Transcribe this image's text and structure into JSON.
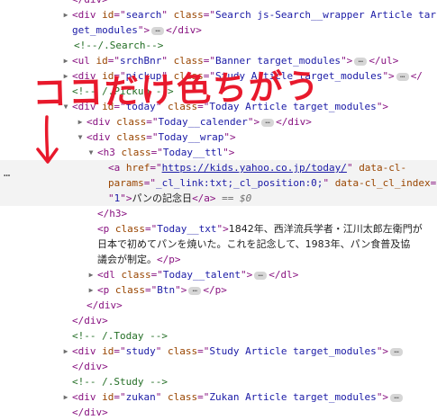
{
  "devtools": {
    "lines": [
      {
        "indent": 80,
        "arrow": "right",
        "html": [
          [
            "tag",
            "<div "
          ],
          [
            "attr",
            "id"
          ],
          [
            "tag",
            "=\""
          ],
          [
            "val",
            "search"
          ],
          [
            "tag",
            "\" "
          ],
          [
            "attr",
            "class"
          ],
          [
            "tag",
            "=\""
          ],
          [
            "val",
            "Search js-Search__wrapper Article tar"
          ]
        ]
      },
      {
        "indent": 80,
        "arrow": "",
        "html": [
          [
            "val",
            "get_modules"
          ],
          [
            "tag",
            "\">"
          ],
          [
            "pill",
            "…"
          ],
          [
            "tag",
            "</div>"
          ]
        ]
      },
      {
        "indent": 82,
        "arrow": "",
        "html": [
          [
            "cmt",
            "<!--/.Search-->"
          ]
        ]
      },
      {
        "indent": 80,
        "arrow": "right",
        "html": [
          [
            "tag",
            "<ul "
          ],
          [
            "attr",
            "id"
          ],
          [
            "tag",
            "=\""
          ],
          [
            "val",
            "srchBnr"
          ],
          [
            "tag",
            "\" "
          ],
          [
            "attr",
            "class"
          ],
          [
            "tag",
            "=\""
          ],
          [
            "val",
            "Banner target_modules"
          ],
          [
            "tag",
            "\">"
          ],
          [
            "pill",
            "…"
          ],
          [
            "tag",
            "</ul>"
          ]
        ]
      },
      {
        "indent": 80,
        "arrow": "right",
        "html": [
          [
            "tag",
            "<div "
          ],
          [
            "attr",
            "id"
          ],
          [
            "tag",
            "=\""
          ],
          [
            "val",
            "pickup"
          ],
          [
            "tag",
            "\" "
          ],
          [
            "attr",
            "class"
          ],
          [
            "tag",
            "=\""
          ],
          [
            "val",
            "Study Article target_modules"
          ],
          [
            "tag",
            "\">"
          ],
          [
            "pill",
            "…"
          ],
          [
            "tag",
            "</"
          ]
        ]
      },
      {
        "indent": 80,
        "arrow": "",
        "html": [
          [
            "cmt",
            "<!-- /.Pickup -->"
          ]
        ]
      },
      {
        "indent": 80,
        "arrow": "down",
        "html": [
          [
            "tag",
            "<div "
          ],
          [
            "attr",
            "id"
          ],
          [
            "tag",
            "=\""
          ],
          [
            "val",
            "today"
          ],
          [
            "tag",
            "\" "
          ],
          [
            "attr",
            "class"
          ],
          [
            "tag",
            "=\""
          ],
          [
            "val",
            "Today Article target_modules"
          ],
          [
            "tag",
            "\">"
          ]
        ]
      },
      {
        "indent": 96,
        "arrow": "right",
        "html": [
          [
            "tag",
            "<div "
          ],
          [
            "attr",
            "class"
          ],
          [
            "tag",
            "=\""
          ],
          [
            "val",
            "Today__calender"
          ],
          [
            "tag",
            "\">"
          ],
          [
            "pill",
            "…"
          ],
          [
            "tag",
            "</div>"
          ]
        ]
      },
      {
        "indent": 96,
        "arrow": "down",
        "html": [
          [
            "tag",
            "<div "
          ],
          [
            "attr",
            "class"
          ],
          [
            "tag",
            "=\""
          ],
          [
            "val",
            "Today__wrap"
          ],
          [
            "tag",
            "\">"
          ]
        ]
      },
      {
        "indent": 108,
        "arrow": "down",
        "html": [
          [
            "tag",
            "<h3 "
          ],
          [
            "attr",
            "class"
          ],
          [
            "tag",
            "=\""
          ],
          [
            "val",
            "Today__ttl"
          ],
          [
            "tag",
            "\">"
          ]
        ]
      },
      {
        "indent": 120,
        "arrow": "",
        "selected": true,
        "html": [
          [
            "tag",
            "<a "
          ],
          [
            "attr",
            "href"
          ],
          [
            "tag",
            "=\""
          ],
          [
            "link",
            "https://kids.yahoo.co.jp/today/"
          ],
          [
            "tag",
            "\" "
          ],
          [
            "attr",
            "data-cl-"
          ]
        ]
      },
      {
        "indent": 120,
        "arrow": "",
        "selected": true,
        "html": [
          [
            "attr",
            "params"
          ],
          [
            "tag",
            "=\""
          ],
          [
            "val",
            "_cl_link:txt;_cl_position:0;"
          ],
          [
            "tag",
            "\" "
          ],
          [
            "attr",
            "data-cl_cl_index"
          ],
          [
            "tag",
            "="
          ]
        ]
      },
      {
        "indent": 120,
        "arrow": "",
        "selected": true,
        "html": [
          [
            "tag",
            "\""
          ],
          [
            "val",
            "1"
          ],
          [
            "tag",
            "\">"
          ],
          [
            "txt",
            "パンの記念日"
          ],
          [
            "tag",
            "</a>"
          ],
          [
            "eq",
            " == $0"
          ]
        ]
      },
      {
        "indent": 108,
        "arrow": "",
        "html": [
          [
            "tag",
            "</h3>"
          ]
        ]
      },
      {
        "indent": 108,
        "arrow": "",
        "html": [
          [
            "tag",
            "<p "
          ],
          [
            "attr",
            "class"
          ],
          [
            "tag",
            "=\""
          ],
          [
            "val",
            "Today__txt"
          ],
          [
            "tag",
            "\">"
          ],
          [
            "txt",
            "1842年、西洋流兵学者・江川太郎左衛門が"
          ]
        ]
      },
      {
        "indent": 108,
        "arrow": "",
        "html": [
          [
            "txt",
            "日本で初めてパンを焼いた。これを記念して、1983年、パン食普及協"
          ]
        ]
      },
      {
        "indent": 108,
        "arrow": "",
        "html": [
          [
            "txt",
            "議会が制定。"
          ],
          [
            "tag",
            "</p>"
          ]
        ]
      },
      {
        "indent": 108,
        "arrow": "right",
        "html": [
          [
            "tag",
            "<dl "
          ],
          [
            "attr",
            "class"
          ],
          [
            "tag",
            "=\""
          ],
          [
            "val",
            "Today__talent"
          ],
          [
            "tag",
            "\">"
          ],
          [
            "pill",
            "…"
          ],
          [
            "tag",
            "</dl>"
          ]
        ]
      },
      {
        "indent": 108,
        "arrow": "right",
        "html": [
          [
            "tag",
            "<p "
          ],
          [
            "attr",
            "class"
          ],
          [
            "tag",
            "=\""
          ],
          [
            "val",
            "Btn"
          ],
          [
            "tag",
            "\">"
          ],
          [
            "pill",
            "…"
          ],
          [
            "tag",
            "</p>"
          ]
        ]
      },
      {
        "indent": 96,
        "arrow": "",
        "html": [
          [
            "tag",
            "</div>"
          ]
        ]
      },
      {
        "indent": 80,
        "arrow": "",
        "html": [
          [
            "tag",
            "</div>"
          ]
        ]
      },
      {
        "indent": 80,
        "arrow": "",
        "html": [
          [
            "cmt",
            "<!-- /.Today -->"
          ]
        ]
      },
      {
        "indent": 80,
        "arrow": "right",
        "html": [
          [
            "tag",
            "<div "
          ],
          [
            "attr",
            "id"
          ],
          [
            "tag",
            "=\""
          ],
          [
            "val",
            "study"
          ],
          [
            "tag",
            "\" "
          ],
          [
            "attr",
            "class"
          ],
          [
            "tag",
            "=\""
          ],
          [
            "val",
            "Study Article target_modules"
          ],
          [
            "tag",
            "\">"
          ],
          [
            "pill",
            "…"
          ]
        ]
      },
      {
        "indent": 80,
        "arrow": "",
        "html": [
          [
            "tag",
            "</div>"
          ]
        ]
      },
      {
        "indent": 80,
        "arrow": "",
        "html": [
          [
            "cmt",
            "<!-- /.Study -->"
          ]
        ]
      },
      {
        "indent": 80,
        "arrow": "right",
        "html": [
          [
            "tag",
            "<div "
          ],
          [
            "attr",
            "id"
          ],
          [
            "tag",
            "=\""
          ],
          [
            "val",
            "zukan"
          ],
          [
            "tag",
            "\" "
          ],
          [
            "attr",
            "class"
          ],
          [
            "tag",
            "=\""
          ],
          [
            "val",
            "Zukan Article target_modules"
          ],
          [
            "tag",
            "\">"
          ],
          [
            "pill",
            "…"
          ]
        ]
      },
      {
        "indent": 80,
        "arrow": "",
        "html": [
          [
            "tag",
            "</div>"
          ]
        ]
      }
    ],
    "top_partial": "</div>",
    "row_more": "…",
    "annotation": {
      "text": "ココだけ色ちがう",
      "color": "#e8192c"
    }
  }
}
